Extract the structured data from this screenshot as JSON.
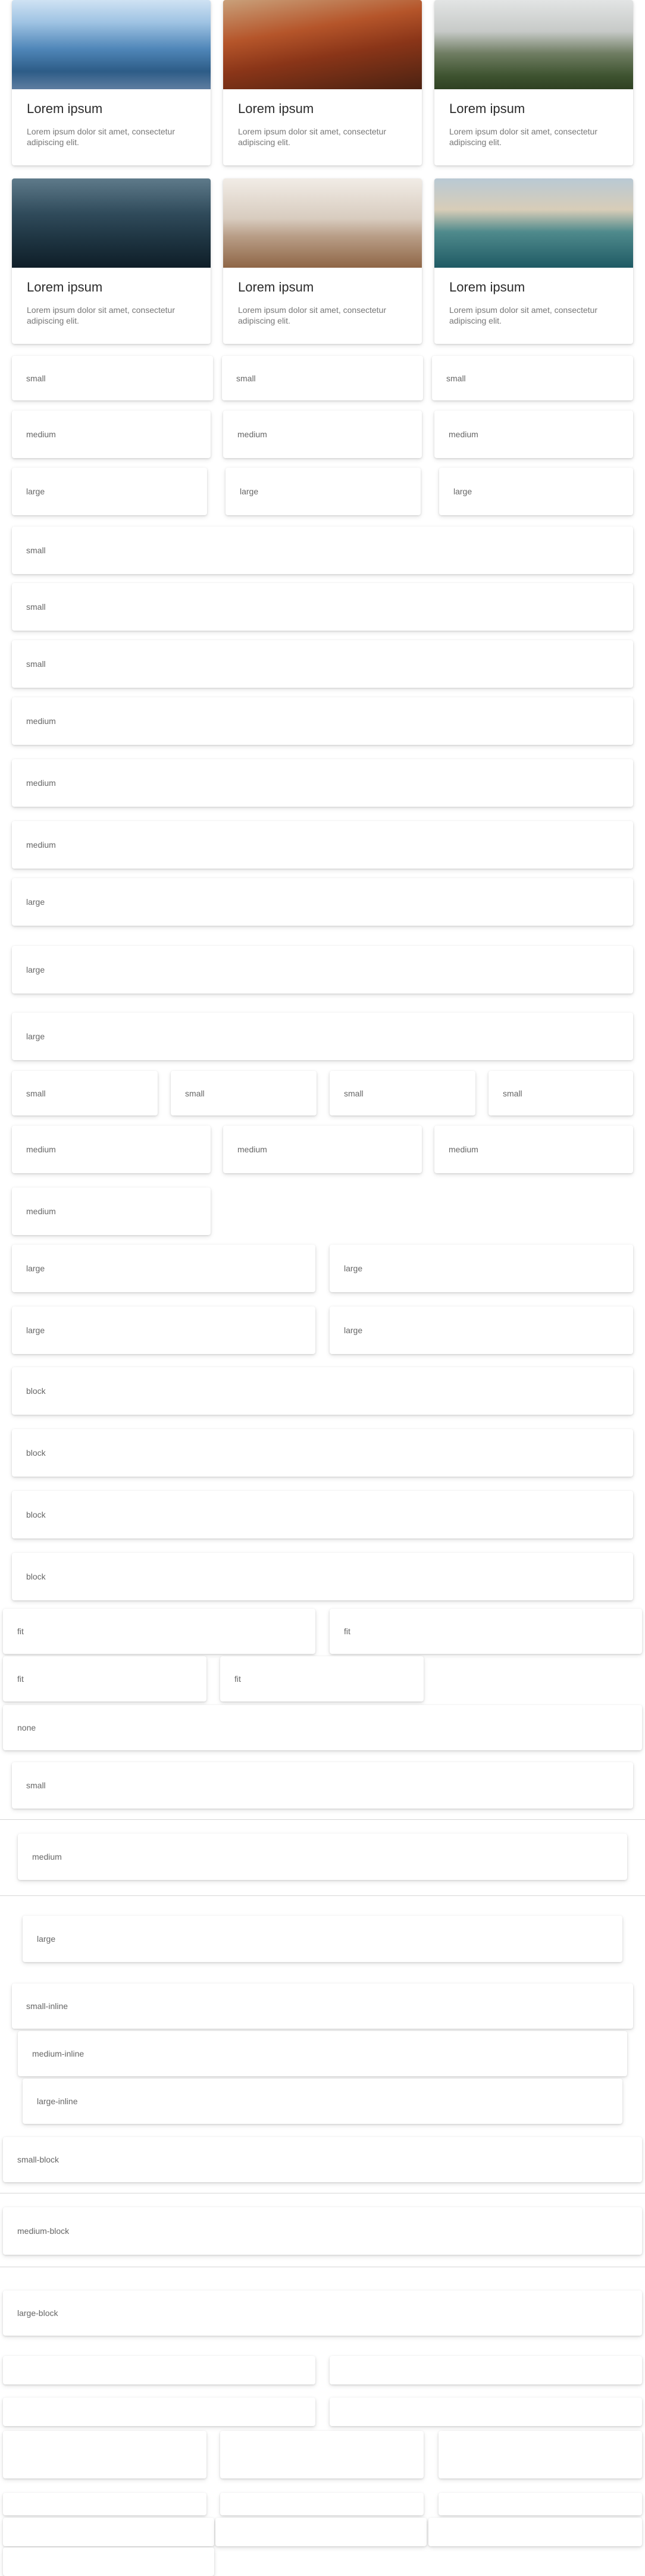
{
  "image_cards": [
    {
      "title": "Lorem ipsum",
      "text": "Lorem ipsum dolor sit amet, consectetur adipiscing elit."
    },
    {
      "title": "Lorem ipsum",
      "text": "Lorem ipsum dolor sit amet, consectetur adipiscing elit."
    },
    {
      "title": "Lorem ipsum",
      "text": "Lorem ipsum dolor sit amet, consectetur adipiscing elit."
    },
    {
      "title": "Lorem ipsum",
      "text": "Lorem ipsum dolor sit amet, consectetur adipiscing elit."
    },
    {
      "title": "Lorem ipsum",
      "text": "Lorem ipsum dolor sit amet, consectetur adipiscing elit."
    },
    {
      "title": "Lorem ipsum",
      "text": "Lorem ipsum dolor sit amet, consectetur adipiscing elit."
    }
  ],
  "labels": {
    "small": "small",
    "medium": "medium",
    "large": "large",
    "block": "block",
    "fit": "fit",
    "none": "none",
    "small_inline": "small-inline",
    "medium_inline": "medium-inline",
    "large_inline": "large-inline",
    "small_block": "small-block",
    "medium_block": "medium-block",
    "large_block": "large-block"
  }
}
